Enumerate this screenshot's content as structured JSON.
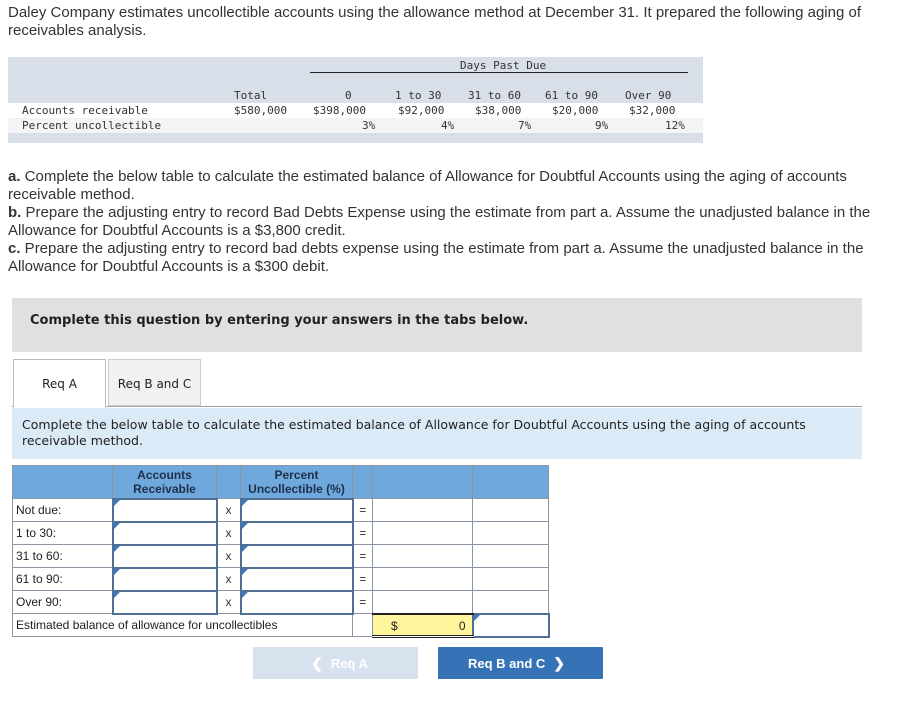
{
  "intro": "Daley Company estimates uncollectible accounts using the allowance method at December 31. It prepared the following aging of receivables analysis.",
  "aging_table": {
    "group_header": "Days Past Due",
    "columns": [
      "Total",
      "0",
      "1 to 30",
      "31 to 60",
      "61 to 90",
      "Over 90"
    ],
    "rows": [
      {
        "label": "Accounts receivable",
        "values": [
          "$580,000",
          "$398,000",
          "$92,000",
          "$38,000",
          "$20,000",
          "$32,000"
        ]
      },
      {
        "label": "Percent uncollectible",
        "values": [
          "",
          "3%",
          "4%",
          "7%",
          "9%",
          "12%"
        ]
      }
    ]
  },
  "requirements": [
    {
      "letter": "a.",
      "text": " Complete the below table to calculate the estimated balance of Allowance for Doubtful Accounts using the aging of accounts receivable method."
    },
    {
      "letter": "b.",
      "text": " Prepare the adjusting entry to record Bad Debts Expense using the estimate from part a. Assume the unadjusted balance in the Allowance for Doubtful Accounts is a $3,800 credit."
    },
    {
      "letter": "c.",
      "text": " Prepare the adjusting entry to record bad debts expense using the estimate from part a. Assume the unadjusted balance in the Allowance for Doubtful Accounts is a $300 debit."
    }
  ],
  "banner": "Complete this question by entering your answers in the tabs below.",
  "tabs": [
    {
      "label": "Req A",
      "active": true
    },
    {
      "label": "Req B and C",
      "active": false
    }
  ],
  "instruction": "Complete the below table to calculate the estimated balance of Allowance for Doubtful Accounts using the aging of accounts receivable method.",
  "calc_table": {
    "headers": {
      "ar": "Accounts Receivable",
      "pct": "Percent Uncollectible (%)"
    },
    "multiply_symbol": "x",
    "equals_symbol": "=",
    "rows": [
      {
        "label": "Not due:",
        "ar_value": "",
        "pct_value": ""
      },
      {
        "label": "1 to 30:",
        "ar_value": "",
        "pct_value": ""
      },
      {
        "label": "31 to 60:",
        "ar_value": "",
        "pct_value": ""
      },
      {
        "label": "61 to 90:",
        "ar_value": "",
        "pct_value": ""
      },
      {
        "label": "Over 90:",
        "ar_value": "",
        "pct_value": ""
      }
    ],
    "total_label": "Estimated balance of allowance for uncollectibles",
    "total_currency": "$",
    "total_value": "0"
  },
  "nav": {
    "prev_label": "Req A",
    "next_label": "Req B and C"
  }
}
